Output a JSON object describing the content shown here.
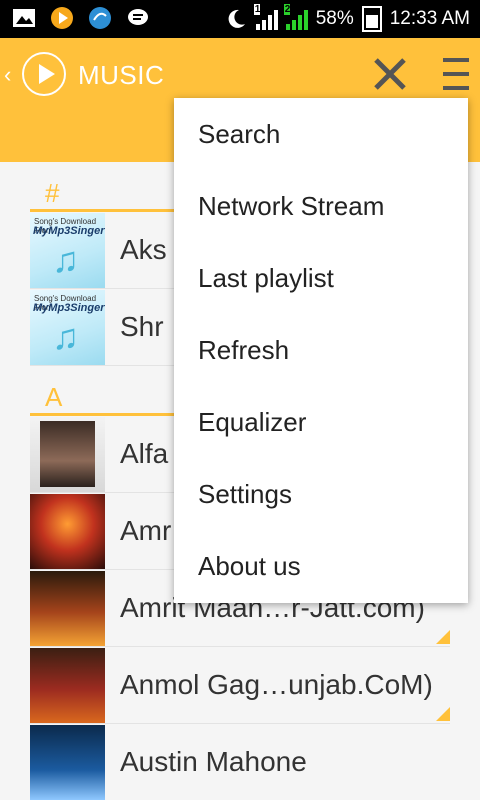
{
  "status_bar": {
    "battery_percent": "58%",
    "time": "12:33 AM",
    "sim1_label": "1",
    "sim2_label": "2",
    "icons": [
      "gallery-icon",
      "music-play-icon",
      "browser-icon",
      "message-icon",
      "moon-icon",
      "signal-icon",
      "battery-icon"
    ]
  },
  "app_bar": {
    "title": "MUSIC"
  },
  "list": {
    "sections": [
      {
        "header": "#",
        "rows": [
          {
            "name": "Aks"
          },
          {
            "name": "Shr"
          }
        ]
      },
      {
        "header": "A",
        "rows": [
          {
            "name": "Alfa"
          },
          {
            "name": "Amr"
          },
          {
            "name": "Amrit Maan…r-Jatt.com)"
          },
          {
            "name": "Anmol Gag…unjab.CoM)"
          },
          {
            "name": "Austin Mahone"
          }
        ]
      }
    ],
    "thumb_text": {
      "mp3_small": "Song's Download From",
      "mp3_brand": "MyMp3Singer"
    }
  },
  "menu": {
    "items": [
      {
        "label": "Search"
      },
      {
        "label": "Network Stream"
      },
      {
        "label": "Last playlist"
      },
      {
        "label": "Refresh"
      },
      {
        "label": "Equalizer"
      },
      {
        "label": "Settings"
      },
      {
        "label": "About us"
      }
    ]
  },
  "colors": {
    "accent": "#ffc13b",
    "status_bar": "#000000",
    "menu_bg": "#ffffff"
  }
}
